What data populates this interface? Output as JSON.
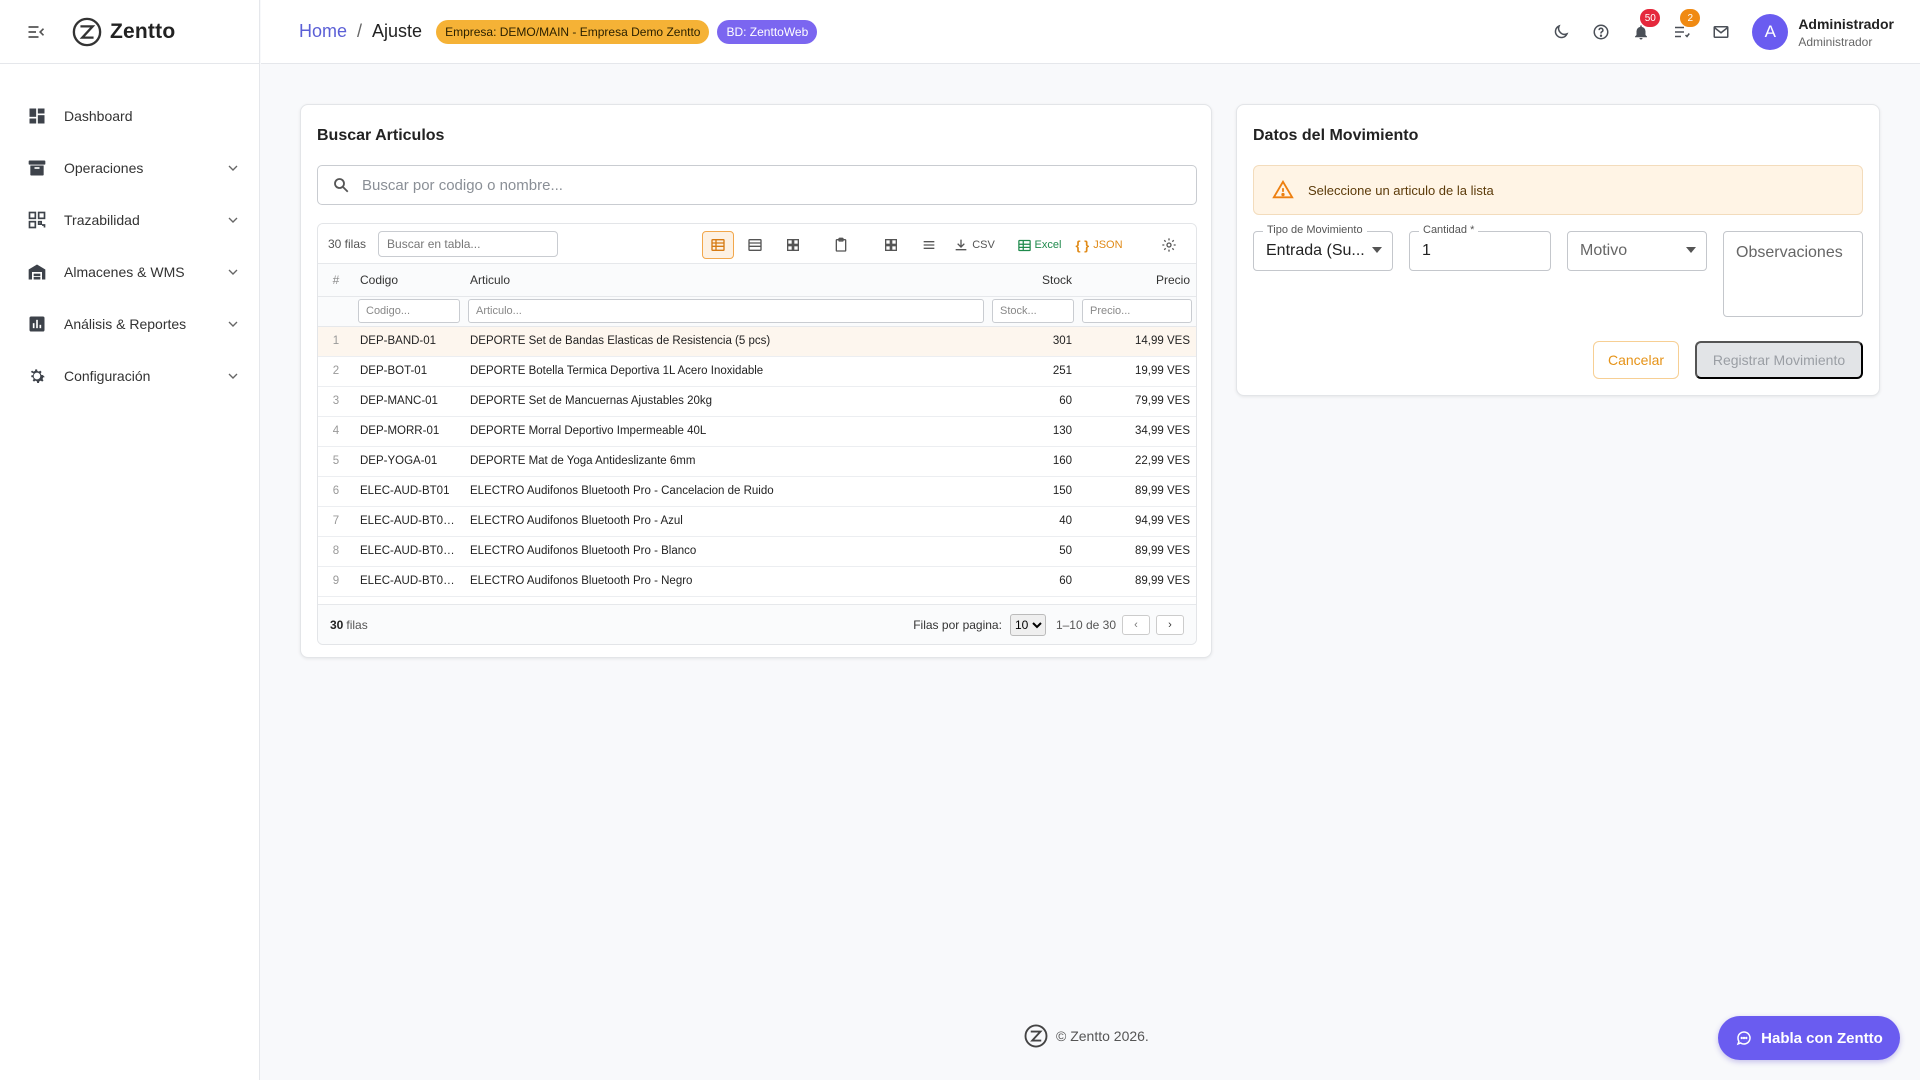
{
  "app": {
    "name": "Zentto"
  },
  "sidebar": {
    "items": [
      {
        "label": "Dashboard",
        "icon": "dashboard-icon"
      },
      {
        "label": "Operaciones",
        "icon": "archive-icon"
      },
      {
        "label": "Trazabilidad",
        "icon": "qr-scan-icon"
      },
      {
        "label": "Almacenes & WMS",
        "icon": "warehouse-icon"
      },
      {
        "label": "Análisis & Reportes",
        "icon": "bar-chart-icon"
      },
      {
        "label": "Configuración",
        "icon": "gear-icon"
      }
    ]
  },
  "topbar": {
    "breadcrumb": {
      "home": "Home",
      "separator": "/",
      "current": "Ajuste"
    },
    "empresa_chip": "Empresa: DEMO/MAIN - Empresa Demo Zentto",
    "bd_chip": "BD: ZenttoWeb",
    "notifications_count": "50",
    "tasks_count": "2",
    "user": {
      "initial": "A",
      "name": "Administrador",
      "role": "Administrador"
    }
  },
  "search_panel": {
    "title": "Buscar Articulos",
    "search_placeholder": "Buscar por codigo o nombre...",
    "grid": {
      "row_count_label": "30 filas",
      "table_filter_placeholder": "Buscar en tabla...",
      "toolbar": {
        "csv": "CSV",
        "excel": "Excel",
        "json": "JSON"
      },
      "columns": {
        "idx": "#",
        "codigo": "Codigo",
        "articulo": "Articulo",
        "stock": "Stock",
        "precio": "Precio"
      },
      "filters": {
        "codigo": "Codigo...",
        "articulo": "Articulo...",
        "stock": "Stock...",
        "precio": "Precio..."
      },
      "rows": [
        {
          "n": "1",
          "codigo": "DEP-BAND-01",
          "articulo": "DEPORTE Set de Bandas Elasticas de Resistencia (5 pcs)",
          "stock": "301",
          "precio": "14,99 VES"
        },
        {
          "n": "2",
          "codigo": "DEP-BOT-01",
          "articulo": "DEPORTE Botella Termica Deportiva 1L Acero Inoxidable",
          "stock": "251",
          "precio": "19,99 VES"
        },
        {
          "n": "3",
          "codigo": "DEP-MANC-01",
          "articulo": "DEPORTE Set de Mancuernas Ajustables 20kg",
          "stock": "60",
          "precio": "79,99 VES"
        },
        {
          "n": "4",
          "codigo": "DEP-MORR-01",
          "articulo": "DEPORTE Morral Deportivo Impermeable 40L",
          "stock": "130",
          "precio": "34,99 VES"
        },
        {
          "n": "5",
          "codigo": "DEP-YOGA-01",
          "articulo": "DEPORTE Mat de Yoga Antideslizante 6mm",
          "stock": "160",
          "precio": "22,99 VES"
        },
        {
          "n": "6",
          "codigo": "ELEC-AUD-BT01",
          "articulo": "ELECTRO Audifonos Bluetooth Pro - Cancelacion de Ruido",
          "stock": "150",
          "precio": "89,99 VES"
        },
        {
          "n": "7",
          "codigo": "ELEC-AUD-BT01...",
          "articulo": "ELECTRO Audifonos Bluetooth Pro - Azul",
          "stock": "40",
          "precio": "94,99 VES"
        },
        {
          "n": "8",
          "codigo": "ELEC-AUD-BT01...",
          "articulo": "ELECTRO Audifonos Bluetooth Pro - Blanco",
          "stock": "50",
          "precio": "89,99 VES"
        },
        {
          "n": "9",
          "codigo": "ELEC-AUD-BT01...",
          "articulo": "ELECTRO Audifonos Bluetooth Pro - Negro",
          "stock": "60",
          "precio": "89,99 VES"
        }
      ],
      "footer": {
        "total_num": "30",
        "total_word": "filas",
        "per_page_label": "Filas por pagina:",
        "per_page_value": "10",
        "range": "1–10 de 30",
        "prev": "‹",
        "next": "›"
      }
    }
  },
  "movement_panel": {
    "title": "Datos del Movimiento",
    "alert": "Seleccione un articulo de la lista",
    "tipo": {
      "label": "Tipo de Movimiento",
      "value": "Entrada (Su..."
    },
    "cantidad": {
      "label": "Cantidad *",
      "value": "1"
    },
    "motivo": {
      "placeholder": "Motivo"
    },
    "observaciones": {
      "placeholder": "Observaciones"
    },
    "cancel_label": "Cancelar",
    "submit_label": "Registrar Movimiento"
  },
  "footer": {
    "copyright": "© Zentto 2026."
  },
  "chat": {
    "label": "Habla con Zentto"
  },
  "colors": {
    "accent": "#6a5cf0",
    "link": "#5b5fd6",
    "warning": "#f5b236",
    "alert_bg": "#fff4e5"
  }
}
